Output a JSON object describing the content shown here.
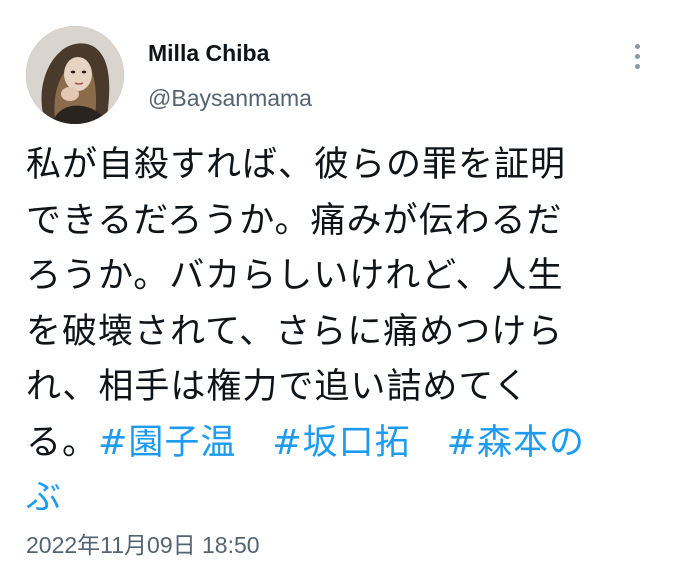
{
  "author": {
    "display_name": "Milla Chiba",
    "handle": "@Baysanmama"
  },
  "tweet": {
    "lines": [
      "私が自殺すれば、彼らの罪を証明",
      "できるだろうか。痛みが伝わるだ",
      "ろうか。バカらしいけれど、人生",
      "を破壊されて、さらに痛めつけら",
      "れ、相手は権力で追い詰めてく",
      "る。"
    ],
    "hashtags": [
      "#園子温",
      "#坂口拓",
      "#森本の",
      "ぶ"
    ],
    "timestamp": "2022年11月09日 18:50"
  },
  "icons": {
    "more": "more-horizontal-dots-icon",
    "avatar": "profile-photo"
  },
  "colors": {
    "text": "#0f1419",
    "secondary": "#536471",
    "hashtag": "#1d9bf0"
  }
}
